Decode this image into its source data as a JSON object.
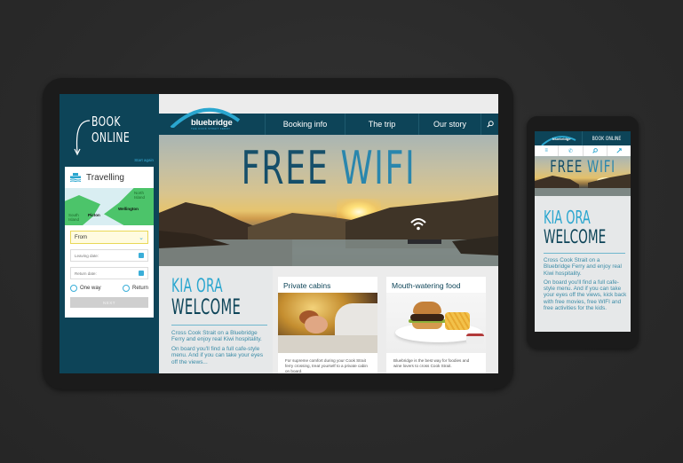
{
  "tablet": {
    "sidebar": {
      "book_online_line1": "BOOK",
      "book_online_line2": "ONLINE",
      "start_again": "Start again",
      "widget": {
        "title": "Travelling",
        "map_labels": {
          "north_island": "North Island",
          "south_island": "South Island",
          "picton": "Picton",
          "wellington": "Wellington"
        },
        "from_select": "From",
        "leaving_date_placeholder": "Leaving date:",
        "return_date_placeholder": "Return date:",
        "radio_one_way": "One way",
        "radio_return": "Return",
        "next_button": "NEXT"
      }
    },
    "nav": {
      "logo_text": "bluebridge",
      "logo_tagline": "THE COOK STRAIT FERRY",
      "items": [
        "Booking info",
        "The trip",
        "Our story"
      ]
    },
    "hero": {
      "title_part1": "FREE",
      "title_part2": "WIFI"
    },
    "welcome": {
      "kia_ora": "KIA ORA",
      "heading": "WELCOME",
      "paragraph1": "Cross Cook Strait on a Bluebridge Ferry and enjoy real Kiwi hospitality.",
      "paragraph2": "On board you'll find a full cafe-style menu. And if you can take your eyes off the views..."
    },
    "cards": [
      {
        "title": "Private cabins",
        "text": "For supreme comfort during your Cook Strait ferry crossing, treat yourself to a private cabin on board."
      },
      {
        "title": "Mouth-watering food",
        "text": "Bluebridge is the best way for foodies and wine lovers to cross Cook Strait."
      }
    ]
  },
  "phone": {
    "logo_text": "bluebridge",
    "book_online": "BOOK ONLINE",
    "icons": [
      "menu-icon",
      "phone-icon",
      "search-icon",
      "location-icon"
    ],
    "hero": {
      "title_part1": "FREE",
      "title_part2": "WIFI"
    },
    "welcome": {
      "kia_ora": "KIA ORA",
      "heading": "WELCOME",
      "paragraph1": "Cross Cook Strait on a Bluebridge Ferry and enjoy real Kiwi hospitality.",
      "paragraph2": "On board you'll find a full cafe-style menu. And if you can take your eyes off the views, kick back with free movies, free WIFI and free activities for the kids."
    }
  },
  "colors": {
    "brand_dark": "#0d4458",
    "brand_light": "#2aa6cf",
    "background": "#2b2b2b"
  }
}
